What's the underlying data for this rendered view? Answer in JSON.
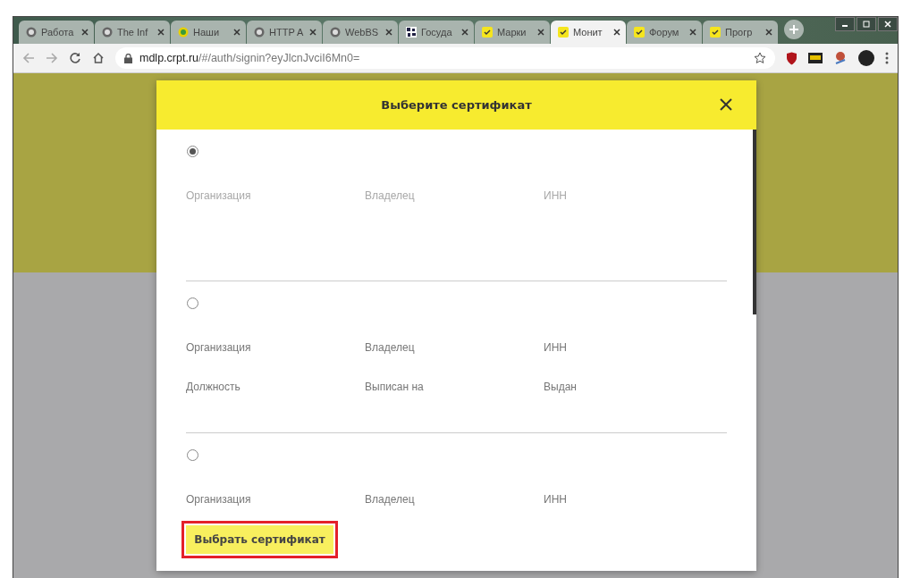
{
  "tabs": [
    {
      "label": "Работа",
      "kind": "globe",
      "selected": false
    },
    {
      "label": "The Inf",
      "kind": "globe",
      "selected": false
    },
    {
      "label": "Наши",
      "kind": "ring",
      "selected": false
    },
    {
      "label": "HTTP A",
      "kind": "globe",
      "selected": false
    },
    {
      "label": "WebBS",
      "kind": "globe",
      "selected": false
    },
    {
      "label": "Госуда",
      "kind": "code",
      "selected": false
    },
    {
      "label": "Марки",
      "kind": "check",
      "selected": false
    },
    {
      "label": "Монит",
      "kind": "check",
      "selected": true
    },
    {
      "label": "Форум",
      "kind": "check",
      "selected": false
    },
    {
      "label": "Прогр",
      "kind": "check",
      "selected": false
    }
  ],
  "address_bar": {
    "host": "mdlp.crpt.ru",
    "path": "/#/auth/signin?eyJlcnJvciI6Mn0="
  },
  "dialog": {
    "title": "Выберите сертификат",
    "certificates": [
      {
        "selected": true,
        "faded": true,
        "fields": [
          {
            "label": "Организация"
          },
          {
            "label": "Владелец"
          },
          {
            "label": "ИНН"
          }
        ]
      },
      {
        "selected": false,
        "faded": false,
        "fields": [
          {
            "label": "Организация"
          },
          {
            "label": "Владелец"
          },
          {
            "label": "ИНН"
          },
          {
            "label": "Должность"
          },
          {
            "label": "Выписан на"
          },
          {
            "label": "Выдан"
          }
        ]
      },
      {
        "selected": false,
        "faded": false,
        "fields": [
          {
            "label": "Организация"
          },
          {
            "label": "Владелец"
          },
          {
            "label": "ИНН"
          }
        ]
      }
    ],
    "button": "Выбрать сертификат"
  }
}
